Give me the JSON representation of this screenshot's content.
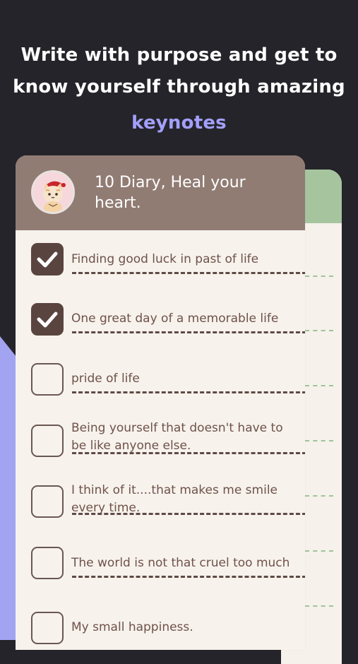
{
  "promo": {
    "headline_line1": "Write with purpose and get to",
    "headline_line2": "know yourself through amazing",
    "headline_accent": "keynotes"
  },
  "diary": {
    "title": "10 Diary, Heal your heart.",
    "items": [
      {
        "text": "Finding good luck in past of life",
        "checked": true
      },
      {
        "text": "One great day of a memorable life",
        "checked": true
      },
      {
        "text": "pride of life",
        "checked": false
      },
      {
        "text": "Being yourself that doesn't have to be like anyone else.",
        "checked": false
      },
      {
        "text": "I think of it....that makes me smile every time.",
        "checked": false
      },
      {
        "text": "The world is not that cruel too much",
        "checked": false
      },
      {
        "text": "My small happiness.",
        "checked": false
      }
    ]
  },
  "colors": {
    "background": "#25242a",
    "accent": "#a3a0ff",
    "card_header": "#917c74",
    "card_body": "#f7f2ec",
    "back_card_header": "#a6c59f",
    "checkbox_dark": "#5a4440",
    "text_brown": "#6f524b"
  },
  "icons": {
    "check": "check-icon",
    "avatar": "cat-avatar-icon"
  }
}
